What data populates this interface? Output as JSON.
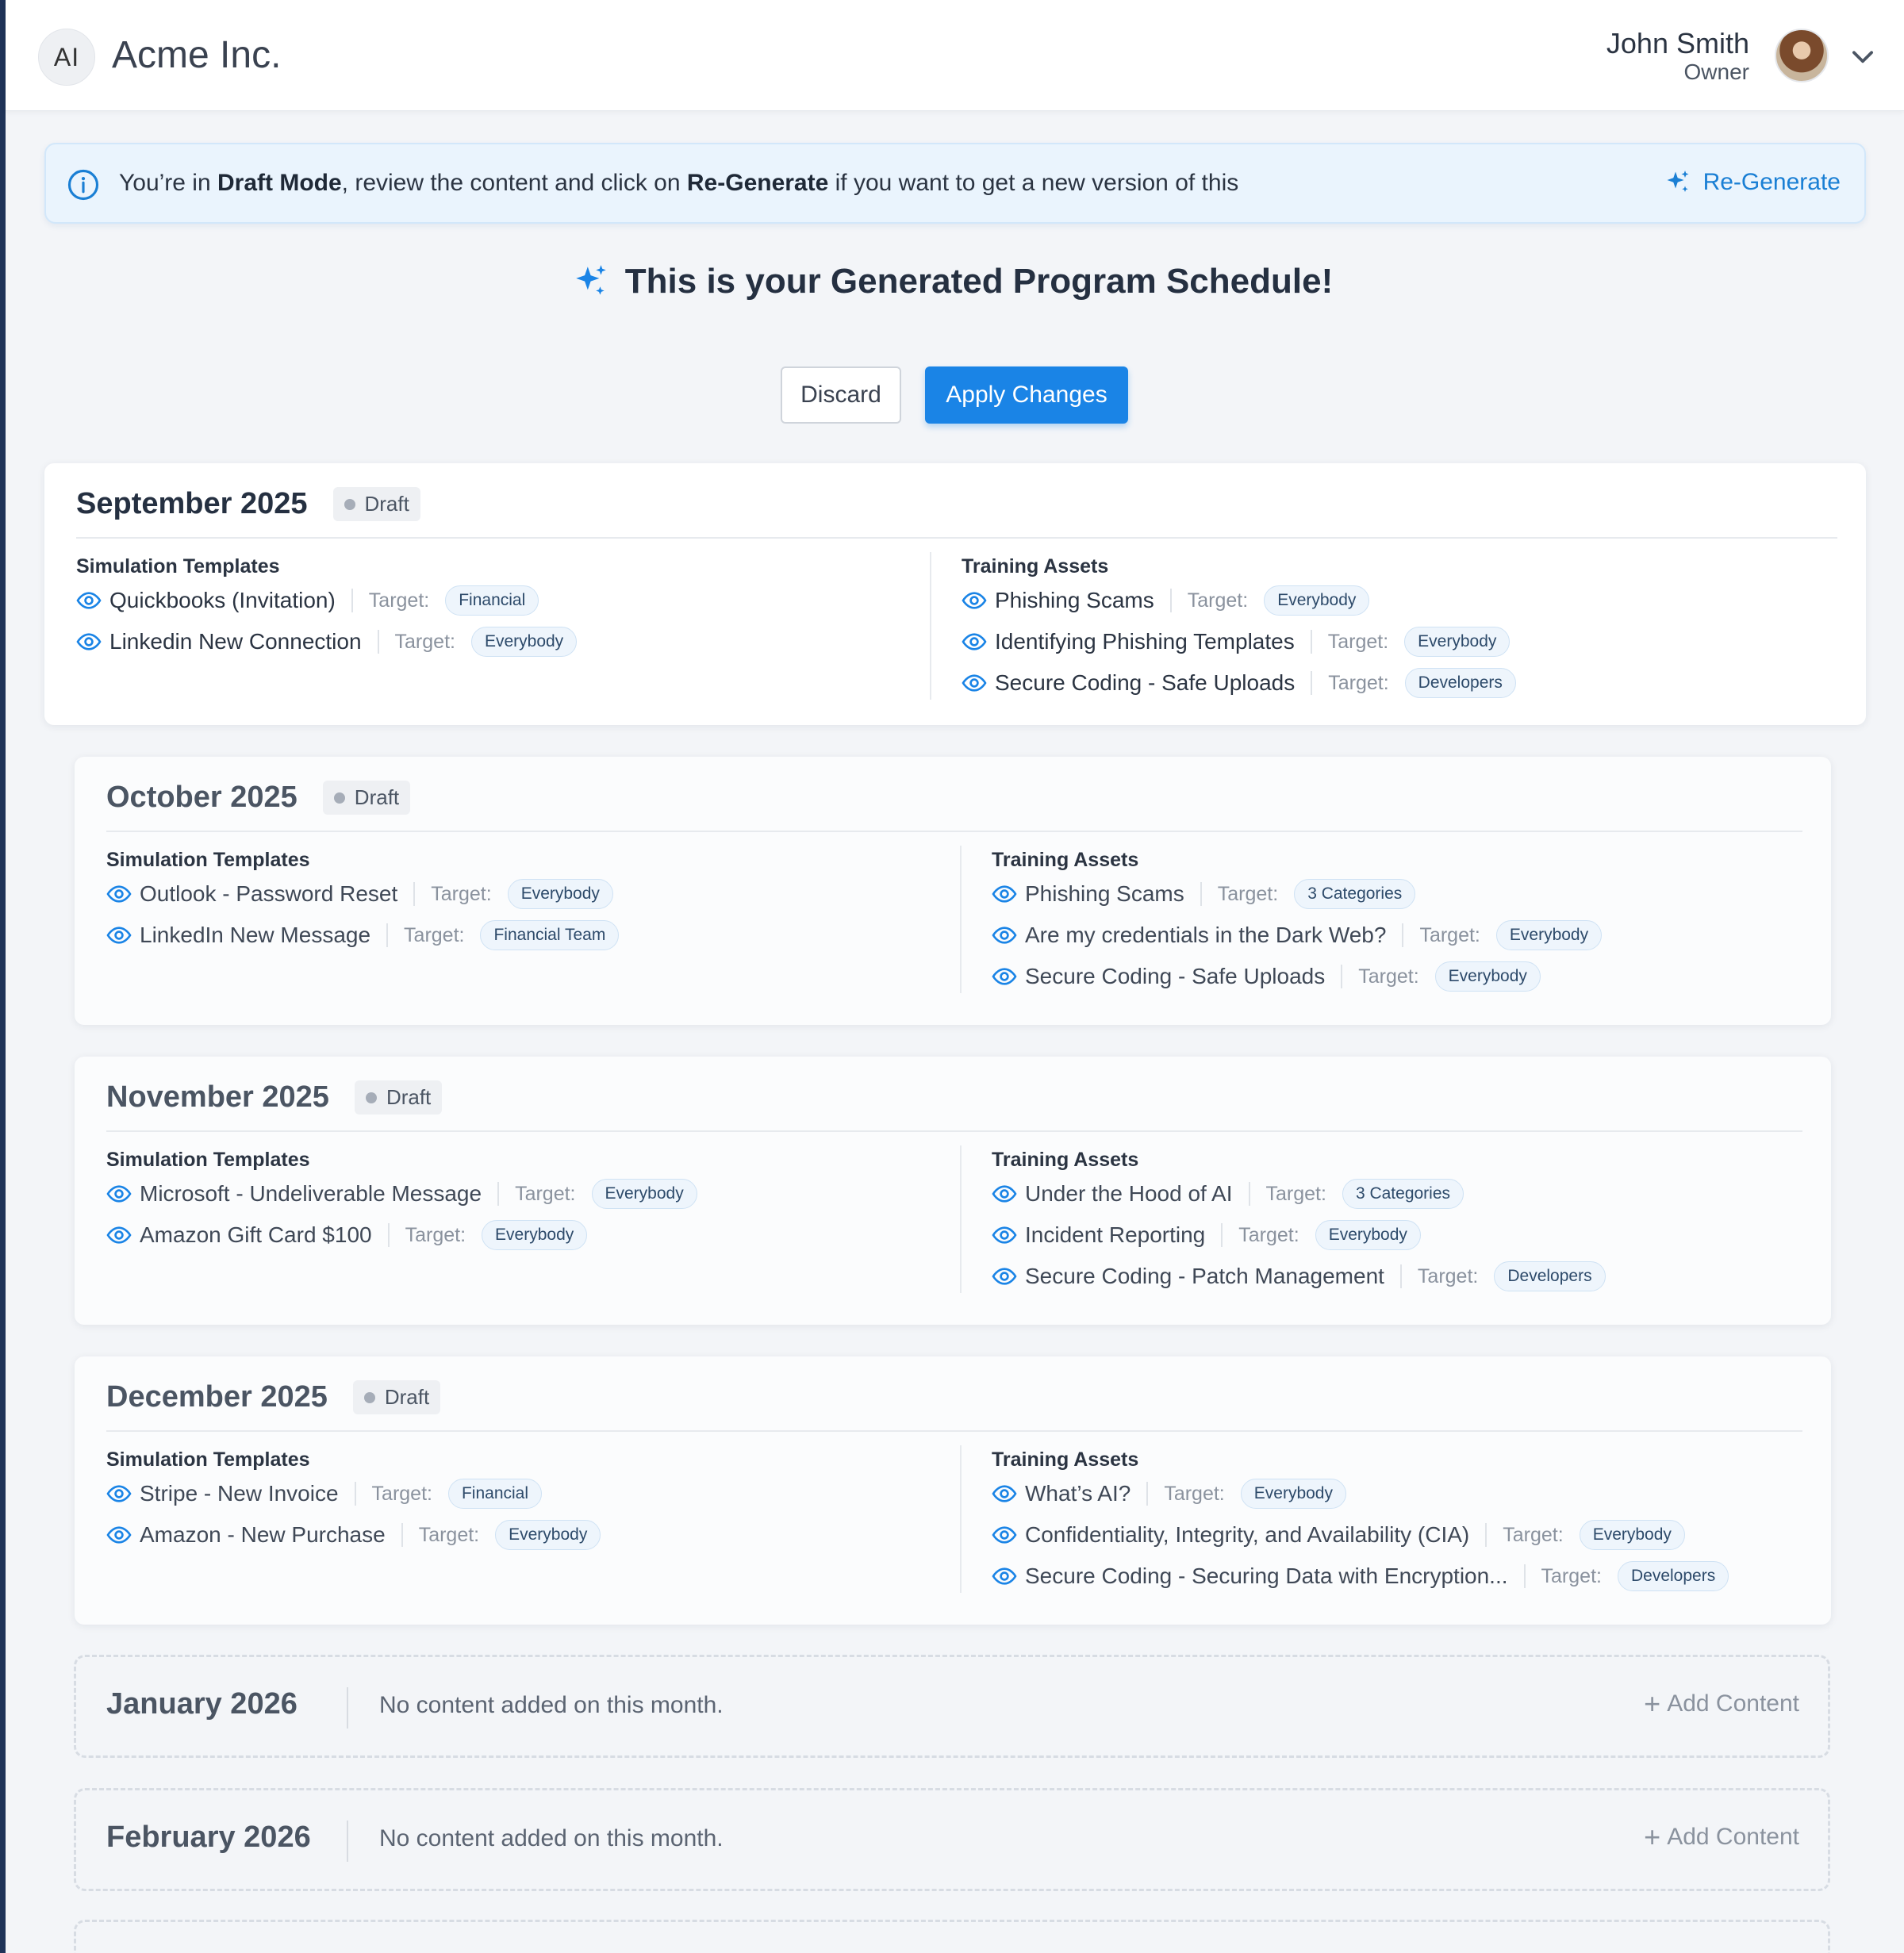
{
  "header": {
    "logo_text": "AI",
    "company": "Acme Inc.",
    "user_name": "John Smith",
    "user_role": "Owner"
  },
  "banner": {
    "text_1": "You’re in ",
    "text_bold_1": "Draft Mode",
    "text_2": ", review the content and click on ",
    "text_bold_2": "Re-Generate",
    "text_3": " if you want to get a new version of this",
    "regenerate_label": "Re-Generate"
  },
  "title": "This is your Generated Program Schedule!",
  "actions": {
    "discard": "Discard",
    "apply": "Apply Changes"
  },
  "labels": {
    "simulation_templates": "Simulation Templates",
    "training_assets": "Training Assets",
    "target": "Target:",
    "draft": "Draft",
    "empty_message": "No content added on this month.",
    "add_content": "Add Content"
  },
  "months": [
    {
      "title": "September  2025",
      "status": "Draft",
      "simulations": [
        {
          "name": "Quickbooks (Invitation)",
          "target": "Financial"
        },
        {
          "name": "Linkedin New Connection",
          "target": "Everybody"
        }
      ],
      "trainings": [
        {
          "name": "Phishing Scams",
          "target": "Everybody"
        },
        {
          "name": "Identifying Phishing Templates",
          "target": "Everybody"
        },
        {
          "name": "Secure Coding - Safe Uploads",
          "target": "Developers"
        }
      ]
    },
    {
      "title": "October 2025",
      "status": "Draft",
      "simulations": [
        {
          "name": "Outlook - Password Reset",
          "target": "Everybody"
        },
        {
          "name": "LinkedIn New Message",
          "target": "Financial Team"
        }
      ],
      "trainings": [
        {
          "name": "Phishing Scams",
          "target": "3 Categories"
        },
        {
          "name": "Are my credentials in the Dark Web?",
          "target": "Everybody"
        },
        {
          "name": "Secure Coding - Safe Uploads",
          "target": "Everybody"
        }
      ]
    },
    {
      "title": "November 2025",
      "status": "Draft",
      "simulations": [
        {
          "name": "Microsoft - Undeliverable Message",
          "target": "Everybody"
        },
        {
          "name": "Amazon Gift Card $100",
          "target": "Everybody"
        }
      ],
      "trainings": [
        {
          "name": "Under the Hood of AI",
          "target": "3 Categories"
        },
        {
          "name": "Incident Reporting",
          "target": "Everybody"
        },
        {
          "name": "Secure Coding - Patch Management",
          "target": "Developers"
        }
      ]
    },
    {
      "title": "December 2025",
      "status": "Draft",
      "simulations": [
        {
          "name": "Stripe - New Invoice",
          "target": "Financial"
        },
        {
          "name": "Amazon - New Purchase",
          "target": "Everybody"
        }
      ],
      "trainings": [
        {
          "name": "What’s AI?",
          "target": "Everybody"
        },
        {
          "name": "Confidentiality, Integrity, and Availability (CIA)",
          "target": "Everybody"
        },
        {
          "name": "Secure Coding - Securing Data with Encryption...",
          "target": "Developers"
        }
      ]
    }
  ],
  "empty_months": [
    {
      "title": "January 2026"
    },
    {
      "title": "February 2026"
    }
  ],
  "colors": {
    "accent": "#1a84e6",
    "banner_bg": "#eaf4fd",
    "page_bg": "#f3f5f8"
  },
  "icons": [
    "info-icon",
    "sparkle-icon",
    "eye-icon",
    "chevron-down-icon",
    "plus-icon"
  ]
}
